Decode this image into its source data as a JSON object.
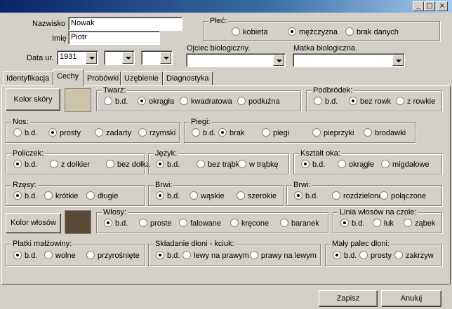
{
  "window": {
    "minimize": "_",
    "maximize": "□",
    "close": "×"
  },
  "person": {
    "surname_label": "Nazwisko",
    "surname_value": "Nowak",
    "name_label": "Imię",
    "name_value": "Piotr",
    "birth_label": "Data ur.",
    "birth_year": "1931",
    "birth_month": "",
    "birth_day": ""
  },
  "sex": {
    "title": "Płeć:",
    "options": [
      "kobieta",
      "mężczyzna",
      "brak danych"
    ],
    "selected": 1
  },
  "father": {
    "label": "Ojciec biologiczny.",
    "value": ""
  },
  "mother": {
    "label": "Matka biologiczna.",
    "value": ""
  },
  "tabs": [
    "Identyfikacja",
    "Cechy",
    "Probówki",
    "Uzębienie",
    "Diagnostyka"
  ],
  "active_tab": 1,
  "colors": {
    "skin": "#cdc3aa",
    "hair": "#5a4a35"
  },
  "skin_button": "Kolor skóry",
  "hair_button": "Kolor włosów",
  "groups": {
    "face": {
      "title": "Twarz:",
      "options": [
        "b.d.",
        "okrągła",
        "kwadratowa",
        "podłużna"
      ],
      "selected": 1
    },
    "chin": {
      "title": "Podbródek:",
      "options": [
        "b.d.",
        "bez rowk",
        "z rowkie"
      ],
      "selected": 1
    },
    "nose": {
      "title": "Nos:",
      "options": [
        "b.d.",
        "prosty",
        "zadarty",
        "rzymski"
      ],
      "selected": 1
    },
    "freckles": {
      "title": "Piegi:",
      "options": [
        "b.d.",
        "brak",
        "piegi",
        "pieprzyki",
        "brodawki"
      ],
      "selected": 1
    },
    "cheeks": {
      "title": "Policzek:",
      "options": [
        "b.d.",
        "z dołkier",
        "bez dołka"
      ],
      "selected": 0
    },
    "tongue": {
      "title": "Język:",
      "options": [
        "b.d.",
        "bez trąbk",
        "w trąbkę"
      ],
      "selected": 0
    },
    "eye_shape": {
      "title": "Kształt oka:",
      "options": [
        "b.d.",
        "okrągłe",
        "migdałowe"
      ],
      "selected": 0
    },
    "lashes": {
      "title": "Rzęsy:",
      "options": [
        "b.d.",
        "krótkie",
        "długie"
      ],
      "selected": 0
    },
    "brows1": {
      "title": "Brwi:",
      "options": [
        "b.d.",
        "wąskie",
        "szerokie"
      ],
      "selected": 0
    },
    "brows2": {
      "title": "Brwi:",
      "options": [
        "b.d.",
        "rozdzielone",
        "połączone"
      ],
      "selected": 0
    },
    "hair": {
      "title": "Włosy:",
      "options": [
        "b.d.",
        "proste",
        "falowane",
        "kręcone",
        "baranek"
      ],
      "selected": 0
    },
    "hairline": {
      "title": "Linia włosów na czole:",
      "options": [
        "b.d.",
        "łuk",
        "ząbek"
      ],
      "selected": 0
    },
    "earlobes": {
      "title": "Płatki małżowiny:",
      "options": [
        "b.d.",
        "wolne",
        "przyrośnięte"
      ],
      "selected": 0
    },
    "hands": {
      "title": "Składanie dłoni - kciuk:",
      "options": [
        "b.d.",
        "lewy na prawym",
        "prawy na lewym"
      ],
      "selected": 0
    },
    "pinky": {
      "title": "Mały palec dłoni:",
      "options": [
        "b.d.",
        "prosty",
        "zakrzyw"
      ],
      "selected": 0
    }
  },
  "footer": {
    "save": "Zapisz",
    "cancel": "Anuluj"
  }
}
